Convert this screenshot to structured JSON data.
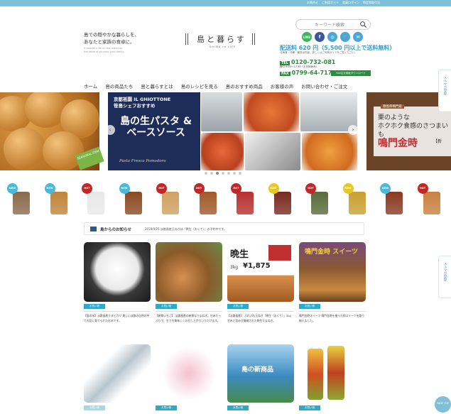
{
  "top_links": [
    "お問合せ",
    "ご利用ガイド",
    "会員ログイン",
    "特定商取引法"
  ],
  "header": {
    "tagline": [
      "島での穏やかな暮らしを、",
      "あなたと家族の食卓に。"
    ],
    "tagline_en": "A peaceful life on the island on the table of you and your family",
    "logo_text": "島と暮らす",
    "logo_sub": "SHIMA to LIFE"
  },
  "search": {
    "placeholder": "キーワード検索"
  },
  "social": [
    {
      "label": "LINE",
      "color": "#3cb65b"
    },
    {
      "label": "f",
      "color": "#3b5998"
    },
    {
      "label": "◎",
      "color": "#4aa8d8"
    },
    {
      "label": "🛒",
      "color": "#4aa8d8"
    },
    {
      "label": "✉",
      "color": "#4aa8d8"
    }
  ],
  "shipping": {
    "title": "配送料 620 円（5,500 円以上で送料無料）",
    "note": "北海道・沖縄・離島は別途。詳しくはご利用ガイドをご覧ください。"
  },
  "contact": {
    "tel_label": "TEL",
    "tel": "0120-732-081",
    "hours": "受付 9:00〜17:30（土日祝休み）",
    "fax_label": "FAX",
    "fax": "0799-64-7177",
    "fax_order": "FAX注文用紙ダウンロード"
  },
  "nav": [
    "ホーム",
    "島の商品たち",
    "島と暮らすとは",
    "島のレシピを見る",
    "島のおすすめ商品",
    "お客様の声",
    "お問い合わせ・ご注文"
  ],
  "hero": {
    "left_ribbon": "SEASONAL ITEM",
    "promo_line1": "京都祇園 IL GHIOTTONE",
    "promo_line2": "笹島シェフおすすめ",
    "promo_title": "島の生パスタ & ベースソース",
    "promo_script": "Pasta Fresca Pomodoro",
    "right_tag": "徳島県鳴門産",
    "right_line1": "栗のような",
    "right_line2": "ホクホク食感のさつまいも",
    "right_title": "鳴門金時",
    "right_suffix": "【新",
    "prev": "‹",
    "next": "›"
  },
  "dots": [
    false,
    false,
    true,
    false,
    false,
    false,
    false
  ],
  "products": [
    {
      "badge": "NEW",
      "badge_color": "#4ab8d8",
      "color": "#8a6a4a"
    },
    {
      "badge": "NEW",
      "badge_color": "#4ab8d8",
      "color": "#c0843a"
    },
    {
      "badge": "HOT",
      "badge_color": "#c02828",
      "color": "#e8e8e8"
    },
    {
      "badge": "NEW",
      "badge_color": "#4ab8d8",
      "color": "#8a4a20"
    },
    {
      "badge": "HOT",
      "badge_color": "#c02828",
      "color": "#d0a060"
    },
    {
      "badge": "HOT",
      "badge_color": "#c02828",
      "color": "#a05a2a"
    },
    {
      "badge": "HOT",
      "badge_color": "#c02828",
      "color": "#b83030"
    },
    {
      "badge": "NEW",
      "badge_color": "#e8c820",
      "color": "#7a2a20"
    },
    {
      "badge": "HOT",
      "badge_color": "#c02828",
      "color": "#5a6a3a"
    },
    {
      "badge": "NEW",
      "badge_color": "#e8c820",
      "color": "#c8a030"
    },
    {
      "badge": "NEW",
      "badge_color": "#4ab8d8",
      "color": "#8a3a20"
    },
    {
      "badge": "HOT",
      "badge_color": "#c02828",
      "color": "#c88040"
    }
  ],
  "news": {
    "title": "島からのお知らせ",
    "text": "2018/9/25 淡路島産玉ねぎは「晩生（おくて）」の予約中です。"
  },
  "cards": [
    {
      "tag": "お買い物",
      "text": "【島の米】淡路島産キヌヒカリ 美しい淡路の自然の中で大切に育てられたお米です。"
    },
    {
      "tag": "お買い物",
      "text": "【新鮮いちご】 淡路島産の新鮮なたまねぎ。甘みたっぷりで、生でも美味しくお召し上がりいただけます。"
    },
    {
      "tag": "お買い物",
      "text": "【淡路島産】 ぷれぷれ玉ねぎ「晩生（おくて）」3kg 甘みと旨みが凝縮された晩生たまねぎ。"
    },
    {
      "tag": "お買い物",
      "text": "鳴門金時スイーツ 鳴門金時を使った和スイーツを取り揃えました。"
    }
  ],
  "cards_row2": [
    {
      "tag": "お買い物",
      "text": ""
    },
    {
      "tag": "お買い物",
      "text": ""
    },
    {
      "tag": "お買い物",
      "text": ""
    },
    {
      "tag": "お買い物",
      "text": ""
    }
  ],
  "promo_banner": {
    "title": "晩生",
    "sub": "3kg",
    "price": "¥1,875"
  },
  "card2_title": "島の新商品",
  "sweets_title": "鳴門金時 スイーツ",
  "side_tabs": [
    "メルマガ登録",
    "メルマガ登録"
  ],
  "pagetop": "PAGE TOP"
}
